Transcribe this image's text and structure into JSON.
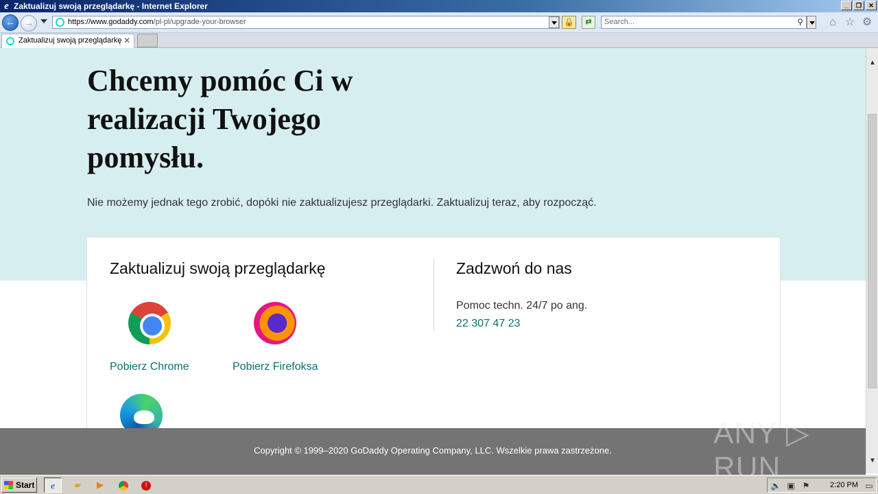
{
  "window": {
    "title": "Zaktualizuj swoją przeglądarkę - Internet Explorer",
    "minimize_glyph": "_",
    "maximize_glyph": "❐",
    "close_glyph": "✕"
  },
  "navbar": {
    "address_host": "https://www.godaddy.com",
    "address_path": "/pl-pl/upgrade-your-browser",
    "search_placeholder": "Search..."
  },
  "tabs": [
    {
      "label": "Zaktualizuj swoją przeglądarkę",
      "active": true
    }
  ],
  "page": {
    "headline": "Chcemy pomóc Ci w realizacji Twojego pomysłu.",
    "subline": "Nie możemy jednak tego zrobić, dopóki nie zaktualizujesz przeglądarki. Zaktualizuj teraz, aby rozpocząć.",
    "card": {
      "left_title": "Zaktualizuj swoją przeglądarkę",
      "browsers": [
        {
          "label": "Pobierz Chrome",
          "icon": "chrome-icon"
        },
        {
          "label": "Pobierz Firefoksa",
          "icon": "firefox-icon"
        },
        {
          "label": "",
          "icon": "edge-icon"
        }
      ],
      "right_title": "Zadzwoń do nas",
      "support_text": "Pomoc techn. 24/7 po ang.",
      "phone": "22 307 47 23"
    },
    "footer": "Copyright © 1999–2020 GoDaddy Operating Company, LLC. Wszelkie prawa zastrzeżone."
  },
  "watermark": "ANY ▷ RUN",
  "taskbar": {
    "start_label": "Start",
    "clock": "2:20 PM"
  },
  "colors": {
    "hero_bg": "#d6eef0",
    "link": "#0a6f6f",
    "footer_bg": "#747474"
  }
}
